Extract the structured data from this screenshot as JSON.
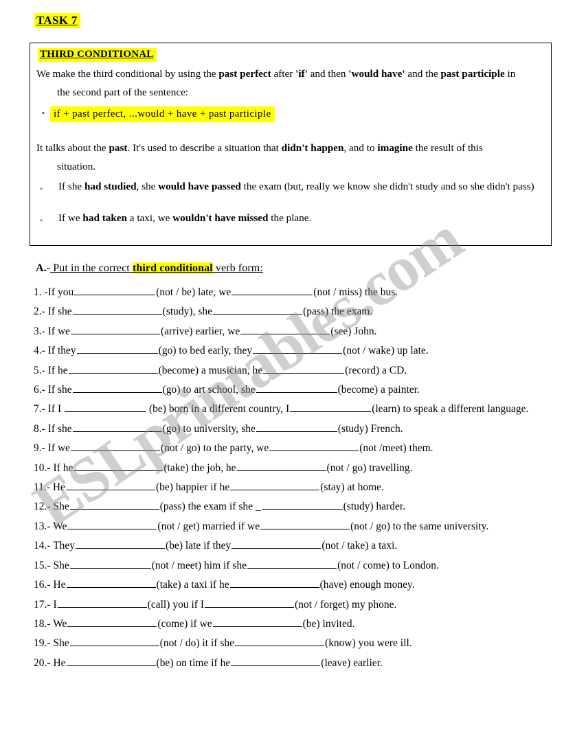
{
  "document": {
    "task_title": "TASK 7",
    "highlight_color": "#ffff00",
    "watermark": "ESLprintables.com"
  },
  "theory": {
    "heading": "THIRD CONDITIONAL",
    "paragraph_1_a": "We make the third conditional by using the ",
    "paragraph_1_b": "past perfect",
    "paragraph_1_c": " after ",
    "paragraph_1_d": "'if'",
    "paragraph_1_e": " and then ",
    "paragraph_1_f": "'would have'",
    "paragraph_1_g": " and the ",
    "paragraph_1_h": "past participle",
    "paragraph_1_i": " in",
    "paragraph_1_cont": "the second part of the sentence:",
    "formula_bullet": "dash-bullet",
    "formula": "if + past perfect, ...would + have + past participle",
    "paragraph_2_a": "It talks about the ",
    "paragraph_2_b": "past",
    "paragraph_2_c": ". It's used to describe a situation that ",
    "paragraph_2_d": "didn't happen",
    "paragraph_2_e": ", and to ",
    "paragraph_2_f": "imagine",
    "paragraph_2_g": " the result of this",
    "paragraph_2_cont": "situation.",
    "examples": [
      {
        "bullet": "dash-bullet",
        "a": "If she ",
        "b": "had studied",
        "c": ", she ",
        "d": "would have passed",
        "e": " the exam (but, really we know she didn't study and so she didn't pass)"
      },
      {
        "bullet": "dash-bullet",
        "a": "If we ",
        "b": "had taken",
        "c": " a taxi, we ",
        "d": "wouldn't have missed",
        "e": " the plane."
      }
    ]
  },
  "section_a": {
    "label": "A.-",
    "text_before": " Put in the correct ",
    "highlighted": "third conditional",
    "text_after": " verb form:"
  },
  "exercises": [
    {
      "n": "1. -",
      "s1": "If you",
      "v1": "(not / be) late, we",
      "v2": "(not / miss) the bus."
    },
    {
      "n": "2.- ",
      "s1": "If she",
      "v1": "(study), she",
      "v2": "(pass) the exam."
    },
    {
      "n": "3.- ",
      "s1": "If we",
      "v1": "(arrive) earlier, we",
      "v2": "(see) John."
    },
    {
      "n": "4.- ",
      "s1": "If they",
      "v1": "(go) to bed early, they",
      "v2": "(not / wake) up late."
    },
    {
      "n": "5.- ",
      "s1": "If he",
      "v1": "(become) a musician, he",
      "v2": "(record) a CD."
    },
    {
      "n": "6.- ",
      "s1": "If she",
      "v1": "(go) to art school, she",
      "v2": "(become) a painter."
    },
    {
      "n": "7.- ",
      "s1": "If I ",
      "v1": " (be) born in a different country, I",
      "v2": "(learn) to speak a different language."
    },
    {
      "n": "8.- ",
      "s1": "If she",
      "v1": "(go) to university, she",
      "v2": "(study) French."
    },
    {
      "n": "9.- ",
      "s1": "If we",
      "v1": "(not / go) to the party, we",
      "v2": "(not /meet) them."
    },
    {
      "n": "10.- ",
      "s1": "If he",
      "v1": "(take) the job, he",
      "v2": "(not / go) travelling."
    },
    {
      "n": "11.- ",
      "s1": "He",
      "v1": "(be) happier if he",
      "v2": "(stay) at home."
    },
    {
      "n": "12.- ",
      "s1": "She",
      "v1": "(pass) the exam if she _",
      "v2": "(study) harder."
    },
    {
      "n": "13.- ",
      "s1": "We",
      "v1": "(not / get) married if we",
      "v2": "(not / go) to the same university."
    },
    {
      "n": "14.- ",
      "s1": "They",
      "v1": "(be) late if they",
      "v2": "(not / take) a taxi."
    },
    {
      "n": "15.- ",
      "s1": "She",
      "v1": "(not / meet) him if she",
      "v2": "(not / come) to London."
    },
    {
      "n": "16.- ",
      "s1": "He",
      "v1": "(take) a taxi if he",
      "v2": "(have) enough money."
    },
    {
      "n": "17.- ",
      "s1": "I",
      "v1": "(call) you if I",
      "v2": "(not / forget) my phone."
    },
    {
      "n": "18.- ",
      "s1": "We",
      "v1": "(come) if we",
      "v2": "(be) invited."
    },
    {
      "n": "19.- ",
      "s1": "She",
      "v1": "(not / do) it if she",
      "v2": "(know) you were ill."
    },
    {
      "n": "20.- ",
      "s1": "He",
      "v1": "(be) on time if he",
      "v2": "(leave) earlier."
    }
  ]
}
